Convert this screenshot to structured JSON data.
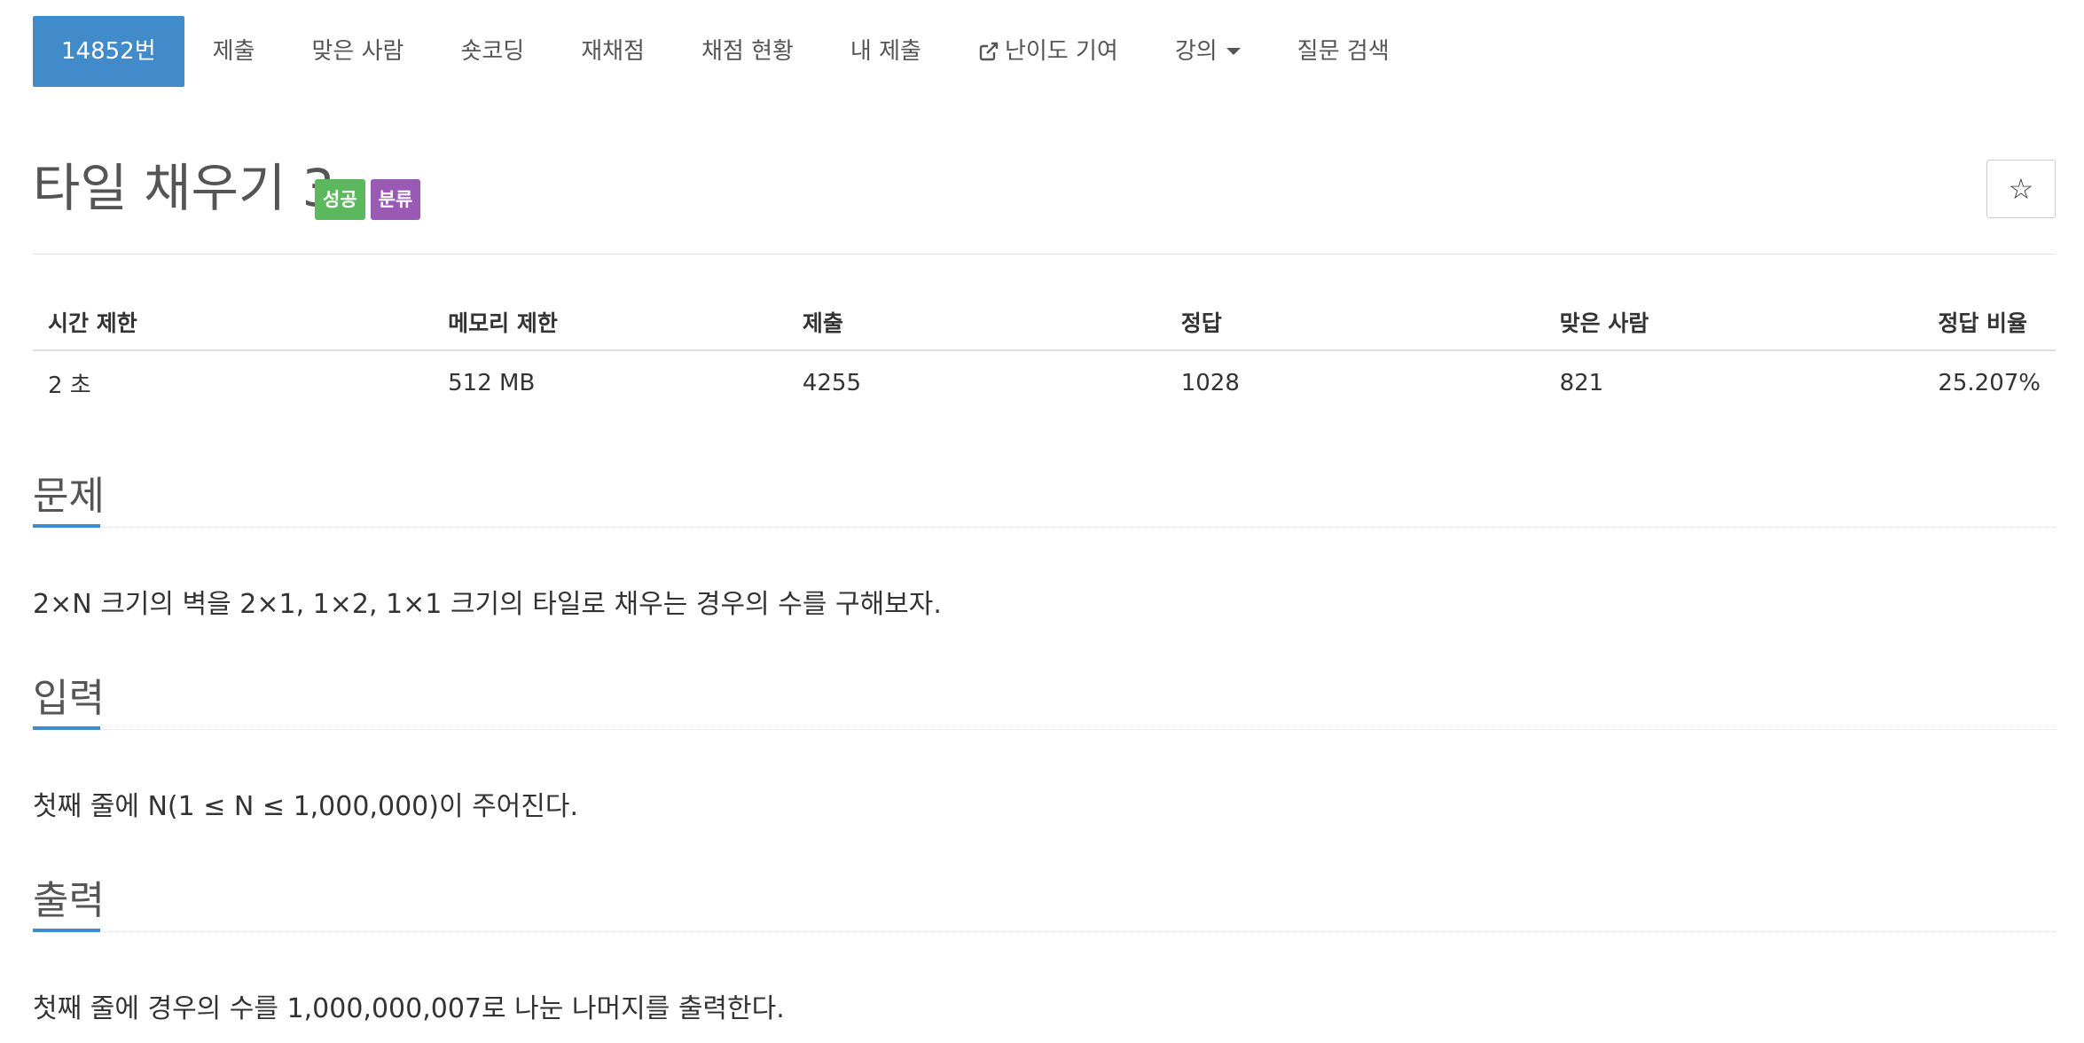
{
  "tabs": [
    {
      "label": "14852번",
      "active": true
    },
    {
      "label": "제출"
    },
    {
      "label": "맞은 사람"
    },
    {
      "label": "숏코딩"
    },
    {
      "label": "재채점"
    },
    {
      "label": "채점 현황"
    },
    {
      "label": "내 제출"
    },
    {
      "label": "난이도 기여",
      "icon": "external-link-icon"
    },
    {
      "label": "강의",
      "icon": "caret-down-icon"
    },
    {
      "label": "질문 검색"
    }
  ],
  "problem": {
    "title": "타일 채우기 3",
    "labels": {
      "success": "성공",
      "category": "분류"
    },
    "star": "☆"
  },
  "info": {
    "headers": [
      "시간 제한",
      "메모리 제한",
      "제출",
      "정답",
      "맞은 사람",
      "정답 비율"
    ],
    "values": [
      "2 초",
      "512 MB",
      "4255",
      "1028",
      "821",
      "25.207%"
    ]
  },
  "sections": {
    "problem": {
      "heading": "문제",
      "text": "2×N 크기의 벽을 2×1, 1×2, 1×1 크기의 타일로 채우는 경우의 수를 구해보자."
    },
    "input": {
      "heading": "입력",
      "text": "첫째 줄에 N(1 ≤ N ≤ 1,000,000)이 주어진다."
    },
    "output": {
      "heading": "출력",
      "text": "첫째 줄에 경우의 수를 1,000,000,007로 나눈 나머지를 출력한다."
    }
  },
  "colors": {
    "primary": "#428bca",
    "success": "#5cb85c",
    "category": "#9b59b6"
  }
}
